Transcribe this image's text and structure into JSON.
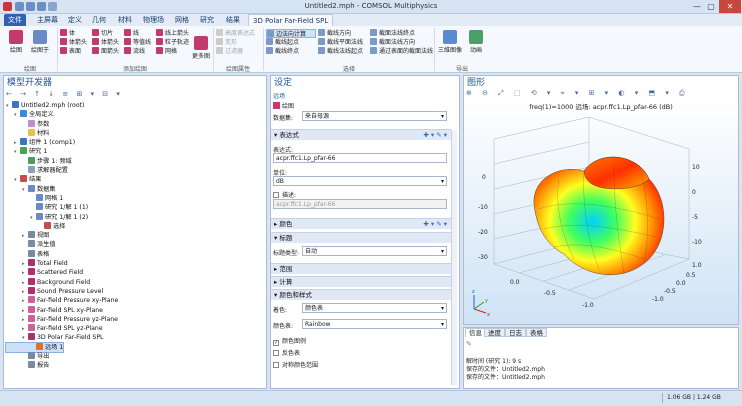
{
  "window": {
    "title": "Untitled2.mph - COMSOL Multiphysics",
    "min": "—",
    "max": "▢",
    "close": "✕"
  },
  "menu": {
    "file": "文件",
    "tabs": [
      "主屏幕",
      "定义",
      "几何",
      "材料",
      "物理场",
      "网格",
      "研究",
      "结果"
    ],
    "active": "3D Polar Far-Field SPL"
  },
  "ribbon": {
    "plot": {
      "plot": "绘图",
      "plot_to": "绘图于",
      "label": "绘图"
    },
    "add": {
      "items_col1": [
        "体",
        "体箭头",
        "表面"
      ],
      "items_col2": [
        "切片",
        "体箭头",
        "面箭头"
      ],
      "items_col3": [
        "线",
        "等值线",
        "流线"
      ],
      "items_col4": [
        "线上箭头",
        "粒子轨迹",
        "网格"
      ],
      "more": "更多图",
      "label": "添加绘图"
    },
    "attr": {
      "items": [
        "高度表达式",
        "变形",
        "过滤器"
      ],
      "label": "绘图属性"
    },
    "select": {
      "col1": [
        "边法向计算",
        "截线起点",
        "截线终点"
      ],
      "col2": [
        "截线方向",
        "截线平面法线",
        "截线法线起点"
      ],
      "col3": [
        "截面法线终点",
        "截面法线方向",
        "通过表面的截面法线"
      ],
      "label": "选择"
    },
    "export": {
      "image": "三维图像",
      "anim": "动画",
      "label": "导出"
    }
  },
  "model_builder": {
    "title": "模型开发器",
    "tree": [
      {
        "d": 0,
        "t": "▾",
        "label": "Untitled2.mph (root)",
        "c": "#3b74c4"
      },
      {
        "d": 1,
        "t": "▾",
        "label": "全局定义",
        "c": "#3b8ad6"
      },
      {
        "d": 2,
        "t": "",
        "label": "参数",
        "c": "#c28ad0"
      },
      {
        "d": 2,
        "t": "",
        "label": "材料",
        "c": "#e8c04a"
      },
      {
        "d": 1,
        "t": "▸",
        "label": "组件 1 (comp1)",
        "c": "#3b74c4"
      },
      {
        "d": 1,
        "t": "▾",
        "label": "研究 1",
        "c": "#4aa05a"
      },
      {
        "d": 2,
        "t": "",
        "label": "步骤 1: 频域",
        "c": "#4aa05a"
      },
      {
        "d": 2,
        "t": "",
        "label": "求解器配置",
        "c": "#8aa0c0"
      },
      {
        "d": 1,
        "t": "▾",
        "label": "结果",
        "c": "#c0504d"
      },
      {
        "d": 2,
        "t": "▾",
        "label": "数据集",
        "c": "#6a8ac8"
      },
      {
        "d": 3,
        "t": "",
        "label": "网格 1",
        "c": "#6a8ac8"
      },
      {
        "d": 3,
        "t": "",
        "label": "研究 1/解 1 (1)",
        "c": "#6a8ac8"
      },
      {
        "d": 3,
        "t": "▾",
        "label": "研究 1/解 1 (2)",
        "c": "#6a8ac8"
      },
      {
        "d": 4,
        "t": "",
        "label": "选择",
        "c": "#c0504d"
      },
      {
        "d": 2,
        "t": "▸",
        "label": "视图",
        "c": "#7a8aa0"
      },
      {
        "d": 2,
        "t": "",
        "label": "派生值",
        "c": "#7a8aa0"
      },
      {
        "d": 2,
        "t": "",
        "label": "表格",
        "c": "#7a8aa0"
      },
      {
        "d": 2,
        "t": "▸",
        "label": "Total Field",
        "c": "#b0306a"
      },
      {
        "d": 2,
        "t": "▸",
        "label": "Scattered Field",
        "c": "#b0306a"
      },
      {
        "d": 2,
        "t": "▸",
        "label": "Background Field",
        "c": "#b0306a"
      },
      {
        "d": 2,
        "t": "▸",
        "label": "Sound Pressure Level",
        "c": "#b0306a"
      },
      {
        "d": 2,
        "t": "▸",
        "label": "Far-field Pressure xy-Plane",
        "c": "#d0609a"
      },
      {
        "d": 2,
        "t": "▸",
        "label": "Far-field SPL xy-Plane",
        "c": "#d0609a"
      },
      {
        "d": 2,
        "t": "▸",
        "label": "Far-field Pressure yz-Plane",
        "c": "#d0609a"
      },
      {
        "d": 2,
        "t": "▸",
        "label": "Far-field SPL yz-Plane",
        "c": "#d0609a"
      },
      {
        "d": 2,
        "t": "▾",
        "label": "3D Polar Far-Field SPL",
        "c": "#b0306a"
      },
      {
        "d": 3,
        "t": "",
        "label": "远场 1",
        "c": "#e07030",
        "sel": true
      },
      {
        "d": 2,
        "t": "",
        "label": "导出",
        "c": "#7a8aa0"
      },
      {
        "d": 2,
        "t": "",
        "label": "报告",
        "c": "#7a8aa0"
      }
    ]
  },
  "settings": {
    "title": "设定",
    "subtitle": "远场",
    "plot_btn": "绘图",
    "dataset_label": "数据集:",
    "dataset_value": "来自母源",
    "expr_section": "表达式",
    "expr_label": "表达式:",
    "expr_value": "acpr.ffc1.Lp_pfar-66",
    "unit_label": "单位:",
    "unit_value": "dB",
    "desc_label": "描述:",
    "desc_value": "acpr.ffc1.Lp_pfar-66",
    "color_section": "颜色",
    "title_section": "标题",
    "title_type_label": "标题类型:",
    "title_type_value": "自动",
    "range_section": "范围",
    "eval_section": "计算",
    "color_style_section": "颜色和样式",
    "coloring_label": "着色:",
    "coloring_value": "颜色表",
    "colortable_label": "颜色表:",
    "colortable_value": "Rainbow",
    "cb_legend": "颜色图例",
    "cb_reverse": "反色表",
    "cb_symmetric": "对称颜色范围"
  },
  "graphics": {
    "title": "图形",
    "plot_title": "freq(1)=1000    远场: acpr.ffc1.Lp_pfar-66 (dB)",
    "axis_labels": [
      "0",
      "-10",
      "-20",
      "-30",
      "10",
      "0",
      "-5",
      "-10",
      "1.0",
      "0.5",
      "0.0",
      "-0.5",
      "-1.0",
      "-1.0",
      "-0.5",
      "0.0"
    ],
    "axis_letters": {
      "x": "x",
      "y": "y",
      "z": "z"
    }
  },
  "log": {
    "tabs": [
      "信息",
      "进度",
      "日志",
      "表格"
    ],
    "lines": [
      "解时间 (研究 1): 9 s",
      "保存的文件：Untitled2.mph",
      "保存的文件：Untitled2.mph"
    ]
  },
  "status": {
    "memory": "1.06 GB | 1.24 GB"
  }
}
